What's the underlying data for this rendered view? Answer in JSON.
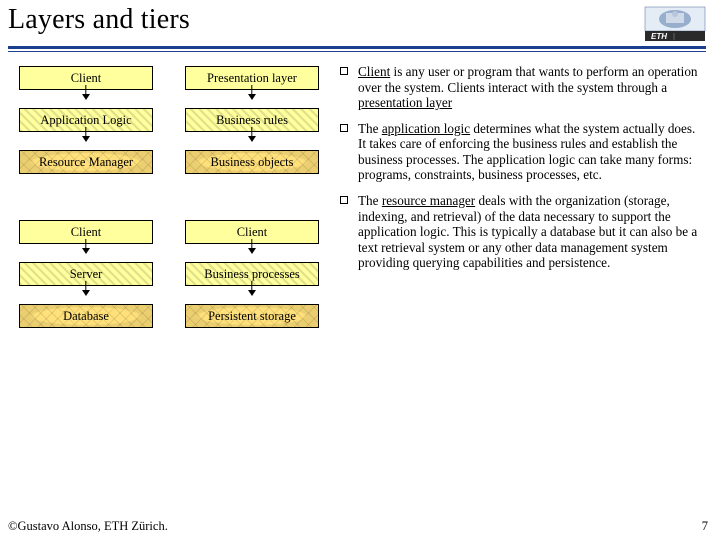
{
  "title": "Layers and tiers",
  "diagram": {
    "col1": [
      "Client",
      "Application Logic",
      "Resource Manager",
      "Client",
      "Server",
      "Database"
    ],
    "col2": [
      "Presentation layer",
      "Business rules",
      "Business objects",
      "Client",
      "Business processes",
      "Persistent storage"
    ]
  },
  "bullets": [
    {
      "lead": "Client",
      "rest": " is any user or program that wants to perform an operation over the system. Clients interact with the system through a ",
      "tail_u": "presentation layer"
    },
    {
      "lead": "",
      "rest": "The ",
      "mid_u": "application logic",
      "rest2": " determines what the system actually does. It takes care of enforcing the business rules and establish the business processes. The application logic can take many forms: programs, constraints, business processes, etc."
    },
    {
      "lead": "",
      "rest": "The ",
      "mid_u": "resource manager",
      "rest2": " deals with the organization (storage, indexing, and retrieval) of the data necessary to support the application logic. This is typically a database but it can also be a text retrieval system or any other data management system providing querying capabilities and persistence."
    }
  ],
  "footer": {
    "copyright": "©Gustavo Alonso,  ETH Zürich.",
    "page": "7"
  }
}
